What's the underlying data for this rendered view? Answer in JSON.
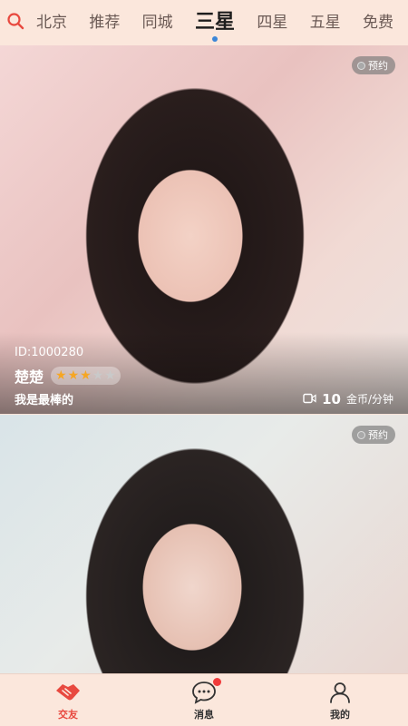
{
  "top_tabs": {
    "items": [
      "北京",
      "推荐",
      "同城",
      "三星",
      "四星",
      "五星",
      "免费"
    ],
    "active_index": 3
  },
  "cards": [
    {
      "badge": "预约",
      "id_text": "ID:1000280",
      "name": "楚楚",
      "stars_filled": 3,
      "stars_total": 5,
      "bio": "我是最棒的",
      "price_value": "10",
      "price_unit": "金币/分钟"
    },
    {
      "badge": "预约"
    }
  ],
  "bottom_nav": {
    "items": [
      {
        "label": "交友",
        "icon": "handshake-icon",
        "active": true
      },
      {
        "label": "消息",
        "icon": "chat-icon",
        "notify": true
      },
      {
        "label": "我的",
        "icon": "person-icon"
      }
    ]
  },
  "colors": {
    "accent": "#e8493f",
    "tab_indicator": "#3b86d8",
    "star": "#f6a623",
    "background": "#fbe7dc"
  }
}
